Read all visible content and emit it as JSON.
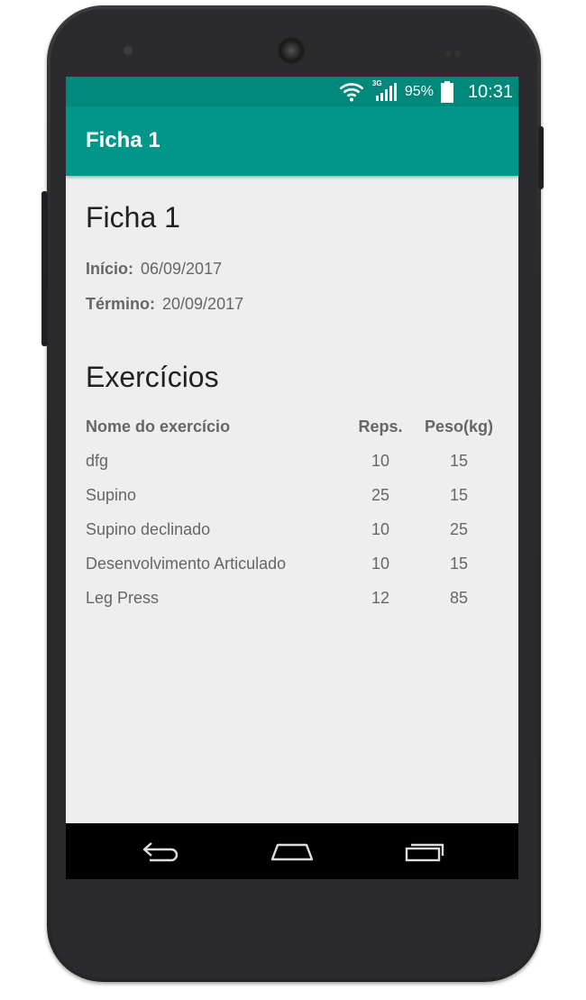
{
  "statusbar": {
    "network": "3G",
    "battery": "95%",
    "time": "10:31"
  },
  "appbar": {
    "title": "Ficha 1"
  },
  "sheet": {
    "title": "Ficha 1",
    "start_label": "Início:",
    "start_value": "06/09/2017",
    "end_label": "Término:",
    "end_value": "20/09/2017"
  },
  "exercises": {
    "section_title": "Exercícios",
    "headers": [
      "Nome do exercício",
      "Reps.",
      "Peso(kg)"
    ],
    "rows": [
      [
        "dfg",
        "10",
        "15"
      ],
      [
        "Supino",
        "25",
        "15"
      ],
      [
        "Supino declinado",
        "10",
        "25"
      ],
      [
        "Desenvolvimento Articulado",
        "10",
        "15"
      ],
      [
        "Leg Press",
        "12",
        "85"
      ]
    ]
  },
  "navbar": {
    "icons": [
      "back-icon",
      "home-icon",
      "recents-icon"
    ]
  },
  "colors": {
    "statusbar": "#00897b",
    "appbar": "#009688",
    "background": "#eeeeee"
  }
}
